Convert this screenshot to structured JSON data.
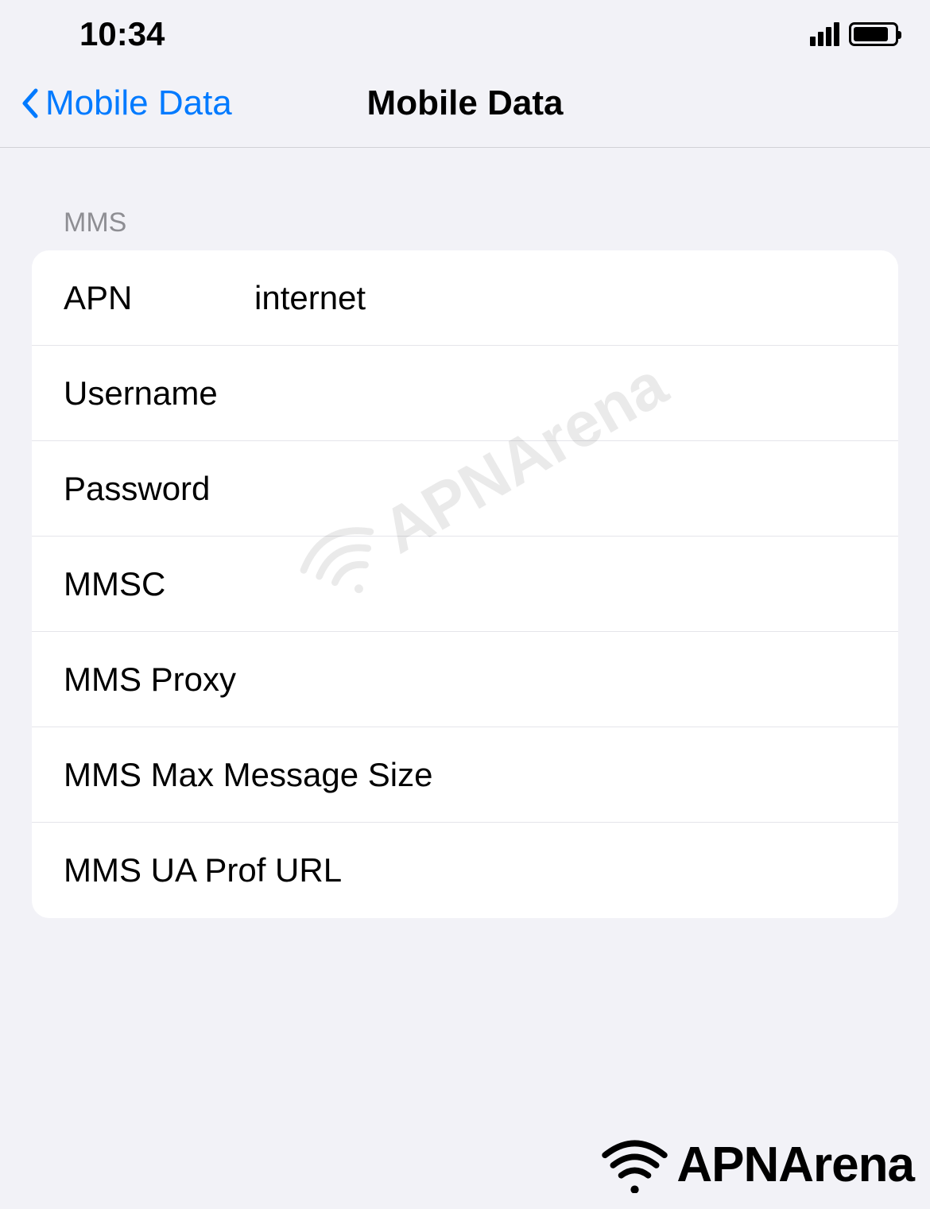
{
  "status_bar": {
    "time": "10:34"
  },
  "nav": {
    "back_label": "Mobile Data",
    "title": "Mobile Data"
  },
  "section": {
    "header": "MMS"
  },
  "fields": {
    "apn": {
      "label": "APN",
      "value": "internet"
    },
    "username": {
      "label": "Username",
      "value": ""
    },
    "password": {
      "label": "Password",
      "value": ""
    },
    "mmsc": {
      "label": "MMSC",
      "value": ""
    },
    "mms_proxy": {
      "label": "MMS Proxy",
      "value": ""
    },
    "mms_max_size": {
      "label": "MMS Max Message Size",
      "value": ""
    },
    "mms_ua_prof": {
      "label": "MMS UA Prof URL",
      "value": ""
    }
  },
  "watermark": {
    "text": "APNArena"
  }
}
